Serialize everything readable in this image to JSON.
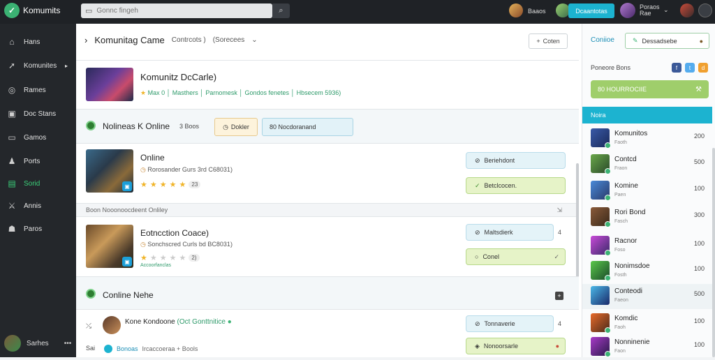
{
  "app": {
    "name": "Komumits",
    "logo_icon": "check-logo-icon"
  },
  "topbar": {
    "search_placeholder": "Gonnc fingeh",
    "search_icon": "search-icon",
    "user1_label": "Baaos",
    "primary_button": "Dcaantotas",
    "user2_label": "Poraos\nRae",
    "dropdown_icon": "chevron-down-icon"
  },
  "sidebar": {
    "items": [
      {
        "label": "Hans",
        "icon": "home-icon"
      },
      {
        "label": "Komunites",
        "icon": "rocket-icon"
      },
      {
        "label": "Rames",
        "icon": "target-icon"
      },
      {
        "label": "Doc Stans",
        "icon": "box-icon"
      },
      {
        "label": "Gamos",
        "icon": "tray-icon"
      },
      {
        "label": "Ports",
        "icon": "person-icon"
      },
      {
        "label": "Sorid",
        "icon": "grid-icon"
      },
      {
        "label": "Annis",
        "icon": "sword-icon"
      },
      {
        "label": "Paros",
        "icon": "users-icon"
      }
    ],
    "active_index": 6,
    "user_name": "Sarhes",
    "more_icon": "ellipsis-icon"
  },
  "main": {
    "breadcrumb": {
      "title": "Komunitag Came",
      "sub1": "Contrcots )",
      "sub2": "(Sorecees"
    },
    "top_button": "Coten",
    "hero": {
      "title": "Komunitz DcCarle)",
      "meta": "Max 0 │ Masthers │ Parnomesk │ Gondos fenetes │ Hbsecem 5936)"
    },
    "online_band": {
      "title": "Nolineas K Online",
      "count": "3 Boos",
      "button1": "Dokler",
      "button2": "80 Nocdoranand"
    },
    "rows": [
      {
        "title": "Online",
        "subtitle": "Rorosander Gurs 3rd C68031)",
        "rating_value": 5,
        "rating_max": 5,
        "rating_pill": "23",
        "action1": "Beriehdont",
        "action2": "Betclcocen."
      },
      {
        "title": "Eotncction Coace)",
        "subtitle": "Sonchscred Curls bd BC8031)",
        "rating_value": 1,
        "rating_max": 5,
        "rating_pill": "2)",
        "rating_note": "Accoorfanclas",
        "action1": "Maltsdierk",
        "action2": "Conel",
        "action1_tail": "4"
      }
    ],
    "subheader": "Boon Nooonoocdeent Onliley",
    "online_news": {
      "title": "Conline Nehe",
      "post_name": "Kone Kondoone",
      "post_tag": "(Oct Gonttnitice",
      "post_id": "Sai",
      "post_links": "Bonoas",
      "post_links_rest": "Ircaccoeraa + Bools",
      "action1": "Tonnaverie",
      "action2": "Nonoorsarle",
      "action1_tail": "4"
    }
  },
  "right_panel": {
    "tab": "Coniioe",
    "button": "Dessadsebe",
    "label": "Poneore Bons",
    "green_button": "80 HOURROCIIE",
    "header": "Noira",
    "items": [
      {
        "name": "Komunitos",
        "sub": "Faoth",
        "count": "200"
      },
      {
        "name": "Contcd",
        "sub": "Fraon",
        "count": "500"
      },
      {
        "name": "Komine",
        "sub": "Paen",
        "count": "100"
      },
      {
        "name": "Rori Bond",
        "sub": "Fasch",
        "count": "300"
      },
      {
        "name": "Racnor",
        "sub": "Foso",
        "count": "100"
      },
      {
        "name": "Nonimsdoe",
        "sub": "Fosth",
        "count": "100"
      },
      {
        "name": "Conteodi",
        "sub": "Faeon",
        "count": "500"
      },
      {
        "name": "Komdic",
        "sub": "Faoh",
        "count": "100"
      },
      {
        "name": "Nonninenie",
        "sub": "Faon",
        "count": "100"
      }
    ]
  }
}
